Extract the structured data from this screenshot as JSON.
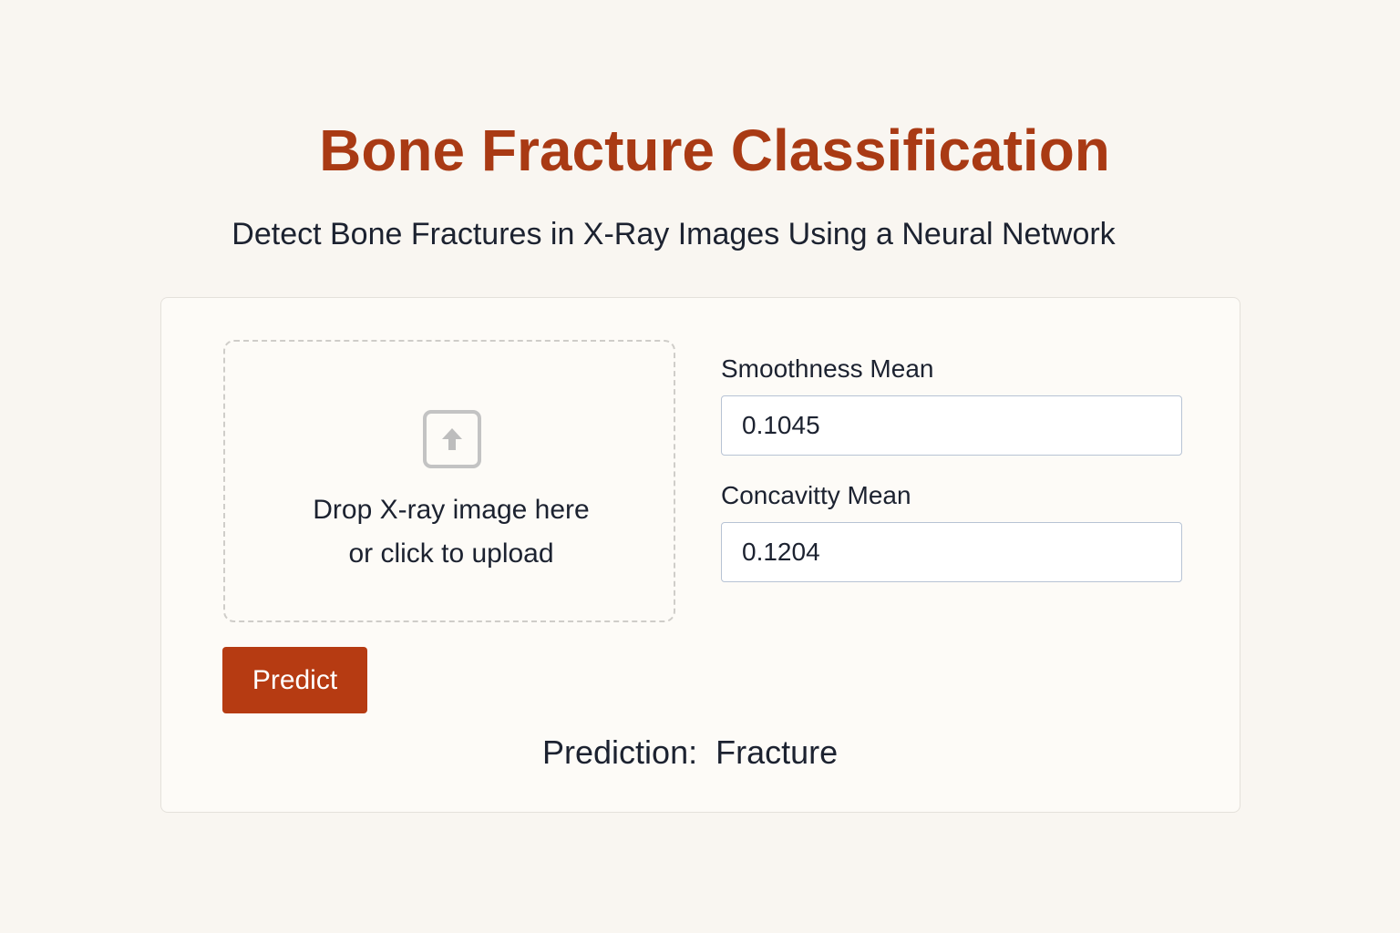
{
  "header": {
    "title": "Bone Fracture Classification",
    "subtitle": "Detect Bone Fractures in X-Ray Images Using a Neural Network"
  },
  "upload": {
    "icon": "upload-icon",
    "line1": "Drop X-ray image here",
    "line2": "or click to upload"
  },
  "fields": {
    "smoothness": {
      "label": "Smoothness Mean",
      "value": "0.1045"
    },
    "concavity": {
      "label": "Concavitty Mean",
      "value": "0.1204"
    }
  },
  "actions": {
    "predict_label": "Predict"
  },
  "result": {
    "prefix": "Prediction:",
    "value": "Fracture"
  },
  "colors": {
    "accent": "#a93a14",
    "button": "#b63b12",
    "background": "#f9f6f1",
    "card": "#fdfbf7"
  }
}
